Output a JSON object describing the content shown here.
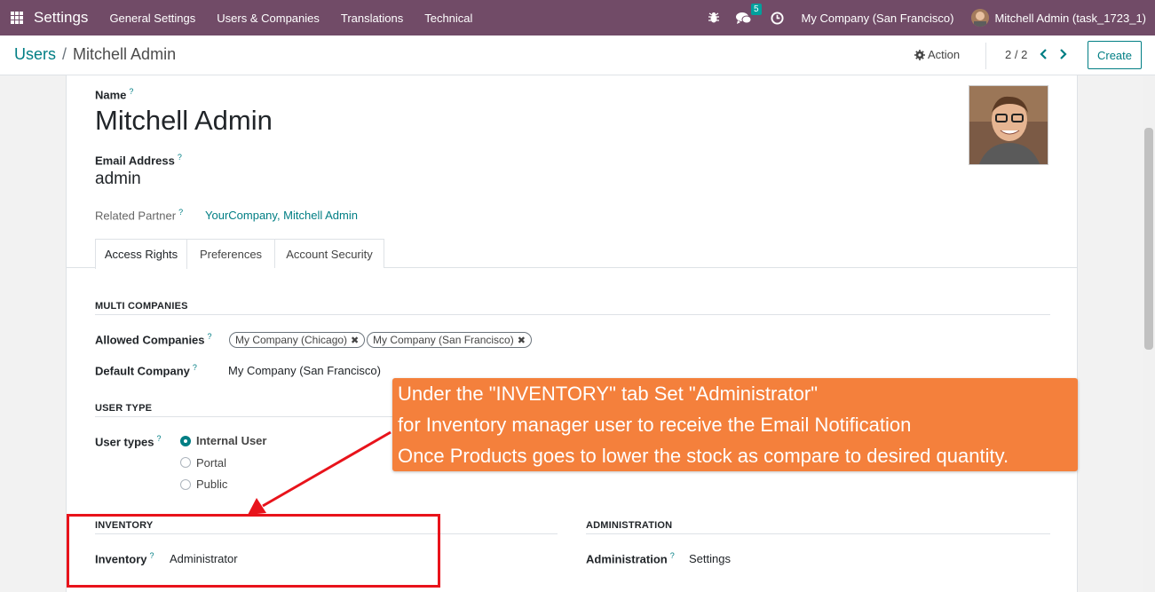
{
  "navbar": {
    "brand": "Settings",
    "menu": [
      "General Settings",
      "Users & Companies",
      "Translations",
      "Technical"
    ],
    "chat_count": "5",
    "company": "My Company (San Francisco)",
    "user": "Mitchell Admin (task_1723_1)"
  },
  "control_panel": {
    "breadcrumb_parent": "Users",
    "breadcrumb_separator": "/",
    "breadcrumb_current": "Mitchell Admin",
    "action_label": "Action",
    "pager": "2 / 2",
    "create_label": "Create"
  },
  "form": {
    "name_label": "Name",
    "name_value": "Mitchell Admin",
    "email_label": "Email Address",
    "email_value": "admin",
    "partner_label": "Related Partner",
    "partner_value": "YourCompany, Mitchell Admin",
    "help_mark": "?"
  },
  "tabs": [
    "Access Rights",
    "Preferences",
    "Account Security"
  ],
  "multi_companies": {
    "title": "MULTI COMPANIES",
    "allowed_label": "Allowed Companies",
    "allowed_tags": [
      "My Company (Chicago)",
      "My Company (San Francisco)"
    ],
    "default_label": "Default Company",
    "default_value": "My Company (San Francisco)"
  },
  "user_type": {
    "title": "USER TYPE",
    "label": "User types",
    "options": [
      "Internal User",
      "Portal",
      "Public"
    ],
    "selected": "Internal User"
  },
  "inventory": {
    "title": "INVENTORY",
    "label": "Inventory",
    "value": "Administrator"
  },
  "administration": {
    "title": "ADMINISTRATION",
    "label": "Administration",
    "value": "Settings"
  },
  "annotation": {
    "lines": [
      "Under the \"INVENTORY\" tab Set \"Administrator\"",
      "for Inventory manager user to receive the Email Notification",
      "Once Products goes to lower the stock as compare to desired quantity."
    ],
    "callout_color": "#f4803c",
    "highlight_color": "#e8131b"
  }
}
